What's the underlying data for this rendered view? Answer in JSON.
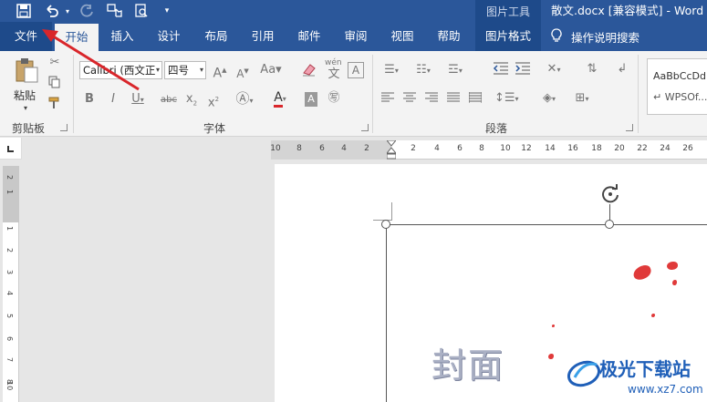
{
  "quick_access": {
    "save_icon": "save-icon",
    "undo_icon": "undo-icon",
    "redo_icon": "redo-icon",
    "touch_icon": "touch-mode-icon",
    "preview_icon": "print-preview-icon",
    "customize_icon": "customize-qat-icon"
  },
  "title": {
    "contextual_tools": "图片工具",
    "document": "散文.docx [兼容模式] - Word"
  },
  "tabs": {
    "file": "文件",
    "home": "开始",
    "insert": "插入",
    "design": "设计",
    "layout": "布局",
    "references": "引用",
    "mailings": "邮件",
    "review": "审阅",
    "view": "视图",
    "help": "帮助",
    "picture_format": "图片格式"
  },
  "tell_me": "操作说明搜索",
  "ribbon": {
    "clipboard": {
      "paste_label": "粘贴",
      "group_label": "剪贴板"
    },
    "font": {
      "font_name": "Calibri (西文正",
      "font_size": "四号",
      "pinyin": "wén",
      "group_label": "字体"
    },
    "paragraph": {
      "group_label": "段落"
    },
    "styles": {
      "preview_1": "AaBbCcDd",
      "preview_2": "↵ WPSOf..."
    }
  },
  "ruler": {
    "h_ticks": [
      "10",
      "8",
      "6",
      "4",
      "2",
      "2",
      "4",
      "6",
      "8",
      "10",
      "12",
      "14",
      "16",
      "18",
      "20",
      "22",
      "24",
      "26"
    ],
    "v_ticks": [
      "2",
      "1",
      "1",
      "2",
      "3",
      "4",
      "5",
      "6",
      "7",
      "8",
      "9",
      "10"
    ]
  },
  "document": {
    "cover_text": "封面"
  },
  "watermark": {
    "name": "极光下载站",
    "url": "www.xz7.com"
  },
  "colors": {
    "title_bar": "#2b579a",
    "ribbon_bg": "#f3f3f3",
    "arrow": "#d9262b"
  }
}
